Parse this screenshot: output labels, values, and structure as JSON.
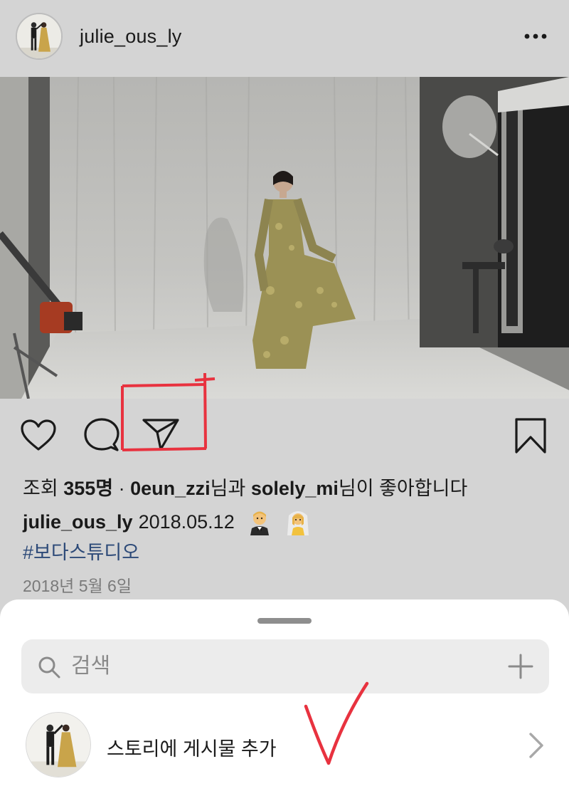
{
  "post": {
    "username": "julie_ous_ly",
    "more_icon": "more-horizontal-icon"
  },
  "actions": {
    "like_icon": "heart-icon",
    "comment_icon": "comment-icon",
    "share_icon": "paper-plane-icon",
    "save_icon": "bookmark-icon"
  },
  "stats": {
    "views_label": "조회",
    "views_count": "355명",
    "separator": " · ",
    "liker1": "0eun_zzi",
    "liker1_suffix": "님과 ",
    "liker2": "solely_mi",
    "liker2_suffix": "님이 좋아합니다"
  },
  "caption": {
    "username": "julie_ous_ly",
    "text": "2018.05.12",
    "emojis": [
      "groom-emoji",
      "bride-emoji"
    ],
    "hashtag": "#보다스튜디오",
    "date": "2018년 5월 6일"
  },
  "sheet": {
    "search_placeholder": "검색",
    "add_story_label": "스토리에 게시물 추가"
  },
  "annotations": {
    "highlight_color": "#e8323f"
  },
  "colors": {
    "background": "#d4d4d4",
    "hashtag": "#2d4a78",
    "sheet": "#ffffff"
  }
}
